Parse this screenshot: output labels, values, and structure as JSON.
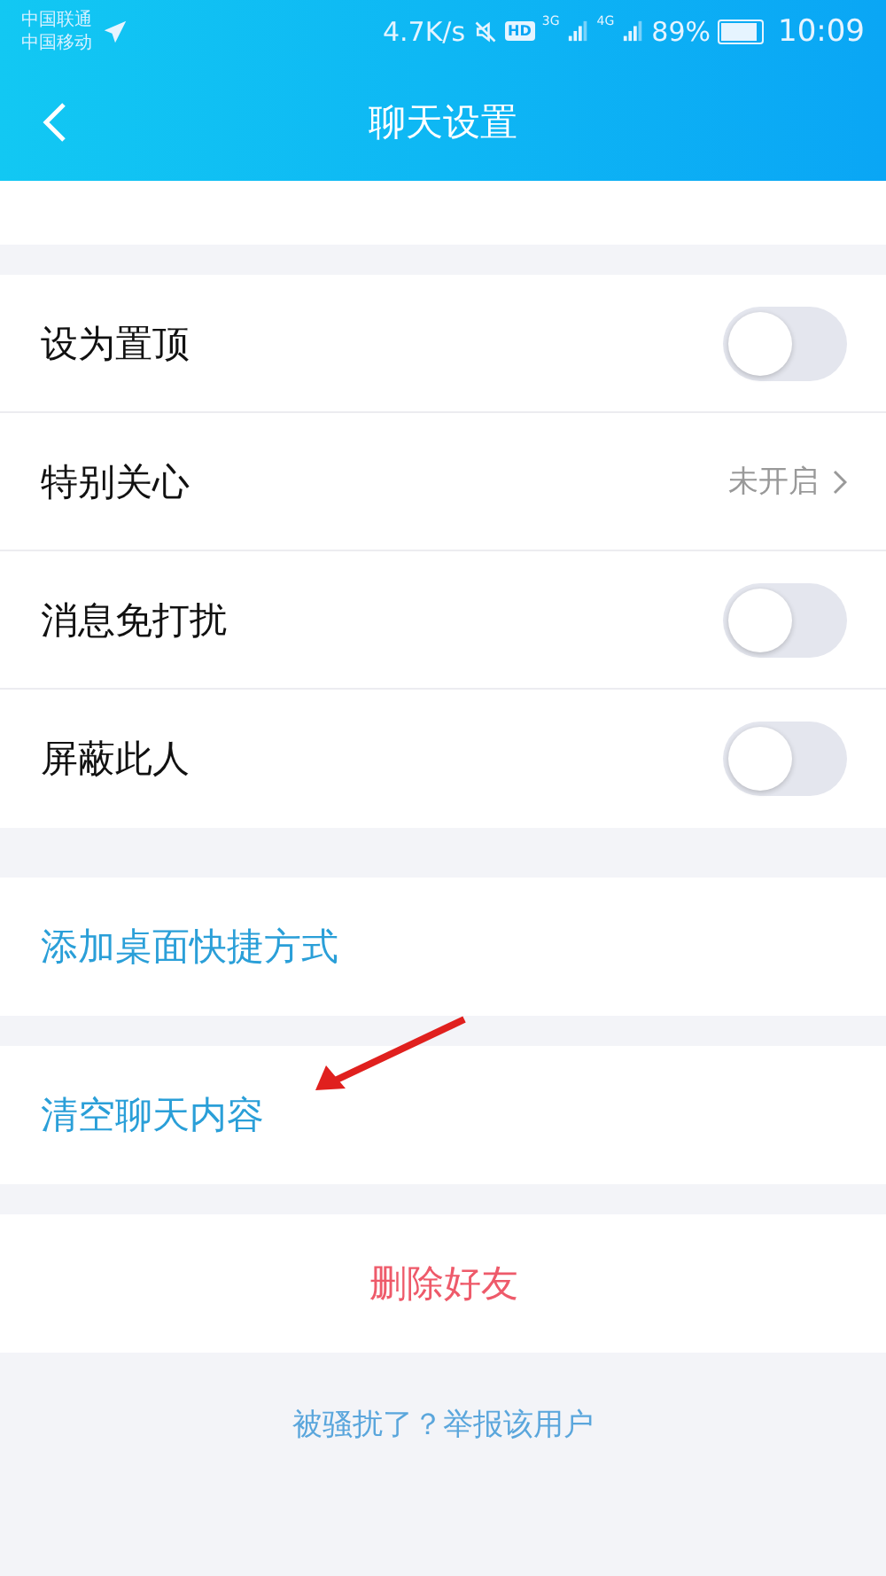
{
  "status_bar": {
    "carriers": [
      "中国联通",
      "中国移动"
    ],
    "speed": "4.7K/s",
    "hd": "HD",
    "networks": [
      "3G",
      "4G"
    ],
    "battery": "89%",
    "time": "10:09"
  },
  "header": {
    "title": "聊天设置"
  },
  "groups": [
    [
      {
        "kind": "toggle",
        "label": "设为置顶",
        "on": false
      },
      {
        "kind": "nav",
        "label": "特别关心",
        "value": "未开启"
      },
      {
        "kind": "toggle",
        "label": "消息免打扰",
        "on": false
      },
      {
        "kind": "toggle",
        "label": "屏蔽此人",
        "on": false
      }
    ],
    [
      {
        "kind": "action",
        "label": "添加桌面快捷方式"
      }
    ],
    [
      {
        "kind": "action",
        "label": "清空聊天内容"
      }
    ],
    [
      {
        "kind": "danger",
        "label": "删除好友"
      }
    ]
  ],
  "footer_link": "被骚扰了？举报该用户"
}
